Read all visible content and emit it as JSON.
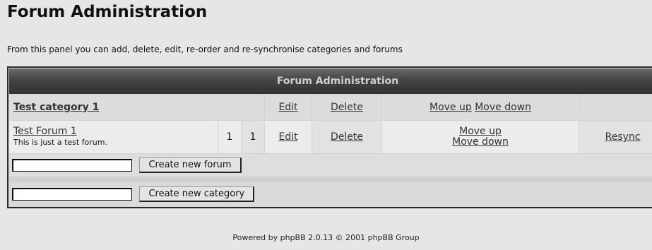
{
  "page": {
    "title": "Forum Administration",
    "intro": "From this panel you can add, delete, edit, re-order and re-synchronise categories and forums"
  },
  "table": {
    "header": "Forum Administration",
    "category": {
      "name": "Test category 1",
      "edit": "Edit",
      "delete": "Delete",
      "move_up": "Move up",
      "move_down": "Move down"
    },
    "forum": {
      "name": "Test Forum 1",
      "description": "This is just a test forum.",
      "topics": "1",
      "posts": "1",
      "edit": "Edit",
      "delete": "Delete",
      "move_up": "Move up",
      "move_down": "Move down",
      "resync": "Resync"
    },
    "create_forum": {
      "value": "",
      "button": "Create new forum"
    },
    "create_category": {
      "value": "",
      "button": "Create new category"
    }
  },
  "footer": "Powered by phpBB 2.0.13 © 2001 phpBB Group"
}
